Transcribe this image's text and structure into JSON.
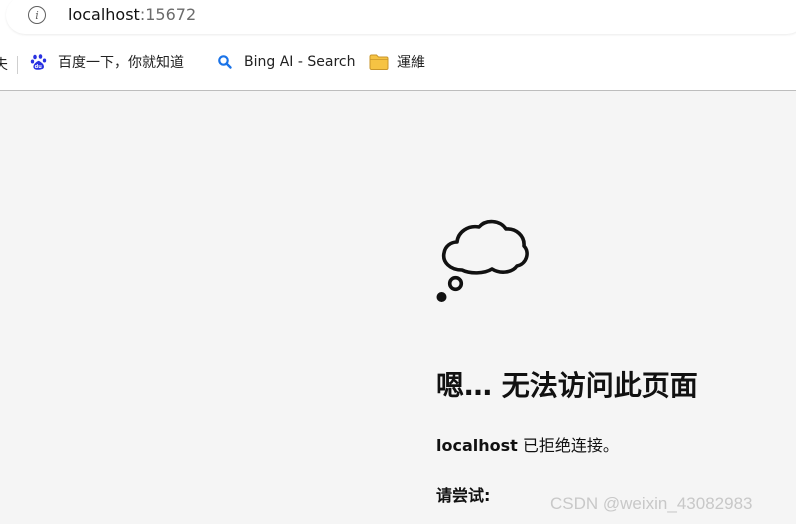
{
  "address_bar": {
    "host": "localhost",
    "port": ":15672",
    "info_icon": "info-icon"
  },
  "bookmarks": {
    "partial_label": "夫",
    "items": [
      {
        "label": "百度一下，你就知道",
        "icon": "baidu-paw-icon"
      },
      {
        "label": "Bing AI - Search",
        "icon": "search-icon"
      },
      {
        "label": "運維",
        "icon": "folder-icon"
      }
    ]
  },
  "error_page": {
    "icon": "thought-cloud-icon",
    "title": "嗯… 无法访问此页面",
    "host": "localhost",
    "message": " 已拒绝连接。",
    "try_heading": "请尝试:"
  },
  "watermark": "CSDN @weixin_43082983",
  "colors": {
    "page_bg": "#f5f5f5",
    "toolbar_bg": "#ffffff",
    "baidu_blue": "#2932e1",
    "search_blue": "#1a73e8",
    "folder_yellow": "#f6c343"
  }
}
